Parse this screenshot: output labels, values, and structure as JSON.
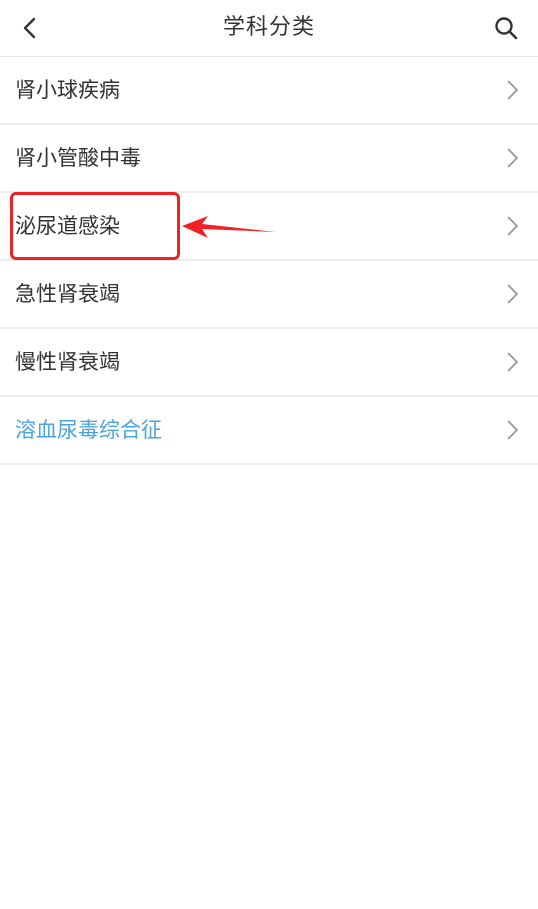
{
  "header": {
    "title": "学科分类",
    "back_icon": "chevron-left-icon",
    "search_icon": "search-icon"
  },
  "list": {
    "items": [
      {
        "label": "肾小球疾病"
      },
      {
        "label": "肾小管酸中毒"
      },
      {
        "label": "泌尿道感染"
      },
      {
        "label": "急性肾衰竭"
      },
      {
        "label": "慢性肾衰竭"
      },
      {
        "label": "溶血尿毒综合征"
      }
    ],
    "chevron_icon": "chevron-right-icon"
  },
  "colors": {
    "text": "#333333",
    "active_text": "#4aa3df",
    "divider": "#eeeeee",
    "annotation": "#ee2222"
  }
}
